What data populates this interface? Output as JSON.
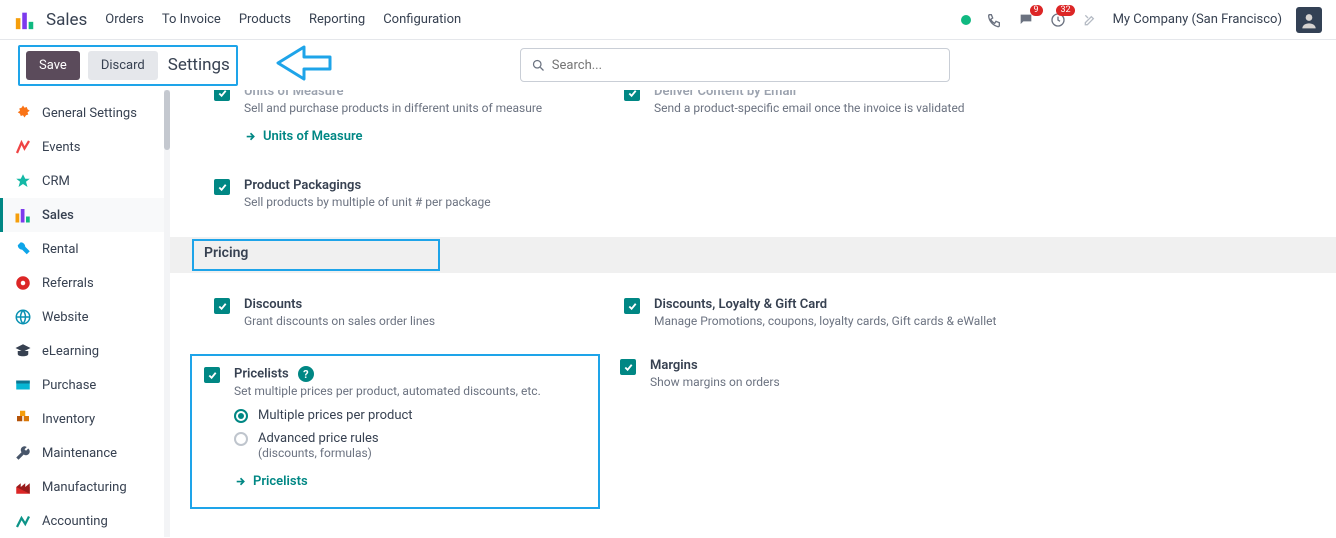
{
  "nav": {
    "brand": "Sales",
    "items": [
      "Orders",
      "To Invoice",
      "Products",
      "Reporting",
      "Configuration"
    ],
    "company": "My Company (San Francisco)",
    "chat_badge": "9",
    "activity_badge": "32"
  },
  "actionbar": {
    "save": "Save",
    "discard": "Discard",
    "crumb": "Settings",
    "search_placeholder": "Search..."
  },
  "sidebar": {
    "items": [
      {
        "label": "General Settings"
      },
      {
        "label": "Events"
      },
      {
        "label": "CRM"
      },
      {
        "label": "Sales"
      },
      {
        "label": "Rental"
      },
      {
        "label": "Referrals"
      },
      {
        "label": "Website"
      },
      {
        "label": "eLearning"
      },
      {
        "label": "Purchase"
      },
      {
        "label": "Inventory"
      },
      {
        "label": "Maintenance"
      },
      {
        "label": "Manufacturing"
      },
      {
        "label": "Accounting"
      }
    ]
  },
  "settings": {
    "uom": {
      "title": "Units of Measure",
      "desc": "Sell and purchase products in different units of measure",
      "link": "Units of Measure"
    },
    "deliver": {
      "title": "Deliver Content by Email",
      "desc": "Send a product-specific email once the invoice is validated"
    },
    "packaging": {
      "title": "Product Packagings",
      "desc": "Sell products by multiple of unit # per package"
    },
    "section_pricing": "Pricing",
    "discounts": {
      "title": "Discounts",
      "desc": "Grant discounts on sales order lines"
    },
    "loyalty": {
      "title": "Discounts, Loyalty & Gift Card",
      "desc": "Manage Promotions, coupons, loyalty cards, Gift cards & eWallet"
    },
    "pricelists": {
      "title": "Pricelists",
      "desc": "Set multiple prices per product, automated discounts, etc.",
      "radio1": "Multiple prices per product",
      "radio2": "Advanced price rules",
      "radio2_sub": "(discounts, formulas)",
      "link": "Pricelists"
    },
    "margins": {
      "title": "Margins",
      "desc": "Show margins on orders"
    }
  },
  "colors": {
    "teal": "#008784",
    "highlight": "#1ea4e9"
  }
}
